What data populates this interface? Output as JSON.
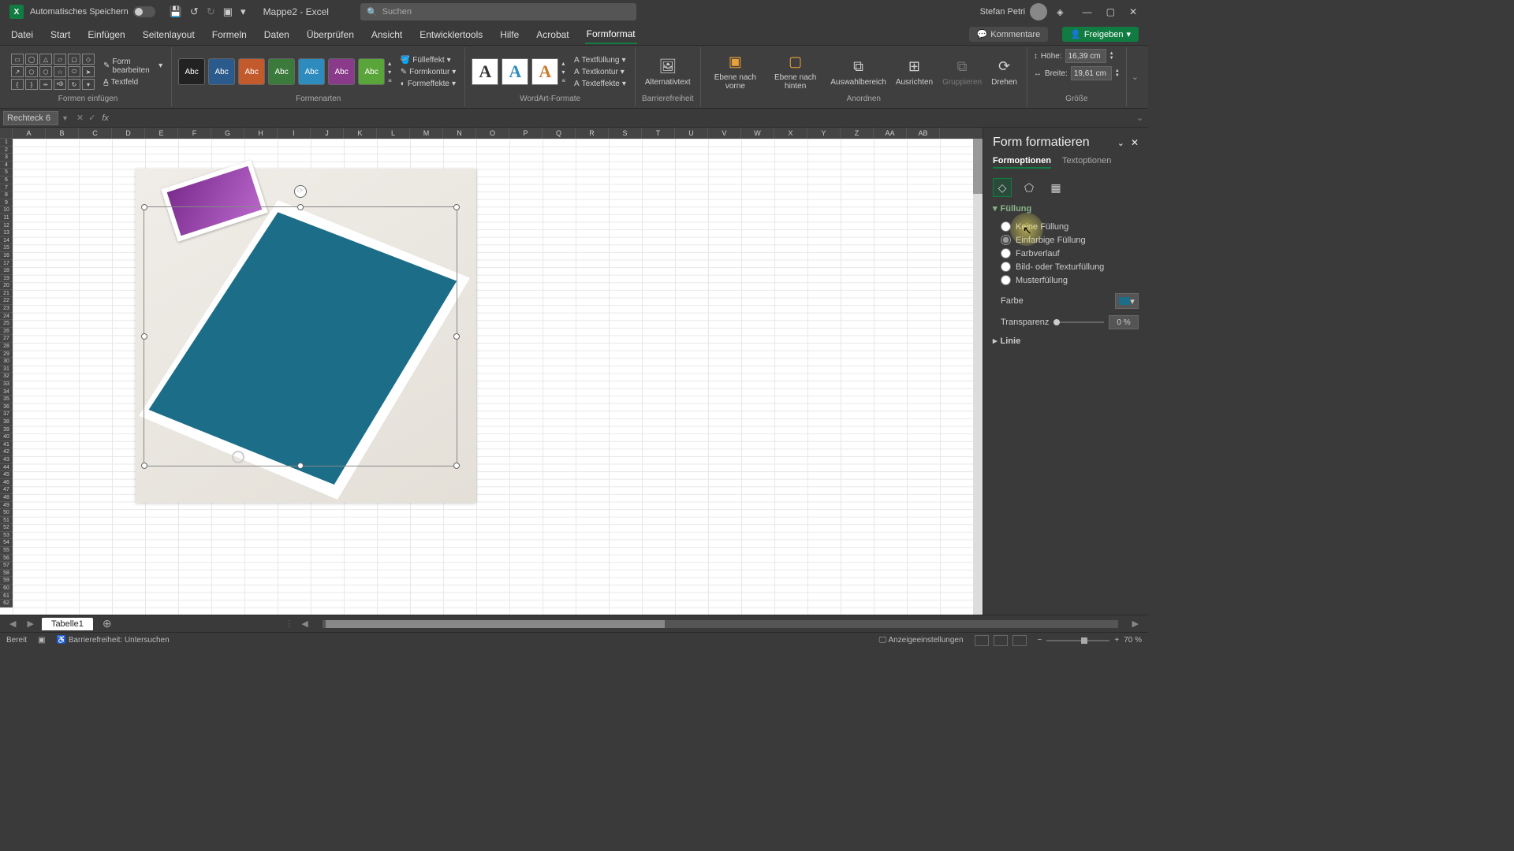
{
  "titlebar": {
    "autosave_label": "Automatisches Speichern",
    "doc_title": "Mappe2 - Excel",
    "search_placeholder": "Suchen",
    "user_name": "Stefan Petri"
  },
  "tabs": {
    "items": [
      "Datei",
      "Start",
      "Einfügen",
      "Seitenlayout",
      "Formeln",
      "Daten",
      "Überprüfen",
      "Ansicht",
      "Entwicklertools",
      "Hilfe",
      "Acrobat",
      "Formformat"
    ],
    "active_index": 11,
    "comments": "Kommentare",
    "share": "Freigeben"
  },
  "ribbon": {
    "formen_einfuegen": {
      "label": "Formen einfügen",
      "form_bearbeiten": "Form bearbeiten",
      "textfeld": "Textfeld"
    },
    "formenarten": {
      "label": "Formenarten",
      "swatch_text": "Abc",
      "colors": [
        "#222",
        "#2b5b8c",
        "#c35a2b",
        "#3a7a3a",
        "#2d8bbd",
        "#8a3a8a",
        "#5aa53a"
      ],
      "fuelleffekt": "Fülleffekt",
      "formkontur": "Formkontur",
      "formeffekte": "Formeffekte"
    },
    "wordart": {
      "label": "WordArt-Formate",
      "swatch_text": "A",
      "colors": [
        "#333",
        "#2d8bbd",
        "#c97a2b"
      ],
      "textfuellung": "Textfüllung",
      "textkontur": "Textkontur",
      "texteffekte": "Texteffekte"
    },
    "barrierefreiheit": {
      "label": "Barrierefreiheit",
      "alternativtext": "Alternativtext"
    },
    "anordnen": {
      "label": "Anordnen",
      "ebene_vorne": "Ebene nach vorne",
      "ebene_hinten": "Ebene nach hinten",
      "auswahlbereich": "Auswahlbereich",
      "ausrichten": "Ausrichten",
      "gruppieren": "Gruppieren",
      "drehen": "Drehen"
    },
    "groesse": {
      "label": "Größe",
      "hoehe_label": "Höhe:",
      "hoehe_value": "16,39 cm",
      "breite_label": "Breite:",
      "breite_value": "19,61 cm"
    }
  },
  "fbar": {
    "namebox": "Rechteck 6"
  },
  "columns": [
    "A",
    "B",
    "C",
    "D",
    "E",
    "F",
    "G",
    "H",
    "I",
    "J",
    "K",
    "L",
    "M",
    "N",
    "O",
    "P",
    "Q",
    "R",
    "S",
    "T",
    "U",
    "V",
    "W",
    "X",
    "Y",
    "Z",
    "AA",
    "AB"
  ],
  "pane": {
    "title": "Form formatieren",
    "tab_formoptionen": "Formoptionen",
    "tab_textoptionen": "Textoptionen",
    "section_fuellung": "Füllung",
    "opt_keine": "Keine Füllung",
    "opt_einfarbig": "Einfarbige Füllung",
    "opt_farbverlauf": "Farbverlauf",
    "opt_bild": "Bild- oder Texturfüllung",
    "opt_muster": "Musterfüllung",
    "farbe": "Farbe",
    "transparenz": "Transparenz",
    "transparenz_value": "0 %",
    "section_linie": "Linie"
  },
  "sheet": {
    "tab1": "Tabelle1"
  },
  "status": {
    "bereit": "Bereit",
    "barrierefreiheit": "Barrierefreiheit: Untersuchen",
    "anzeige": "Anzeigeeinstellungen",
    "zoom": "70 %"
  }
}
